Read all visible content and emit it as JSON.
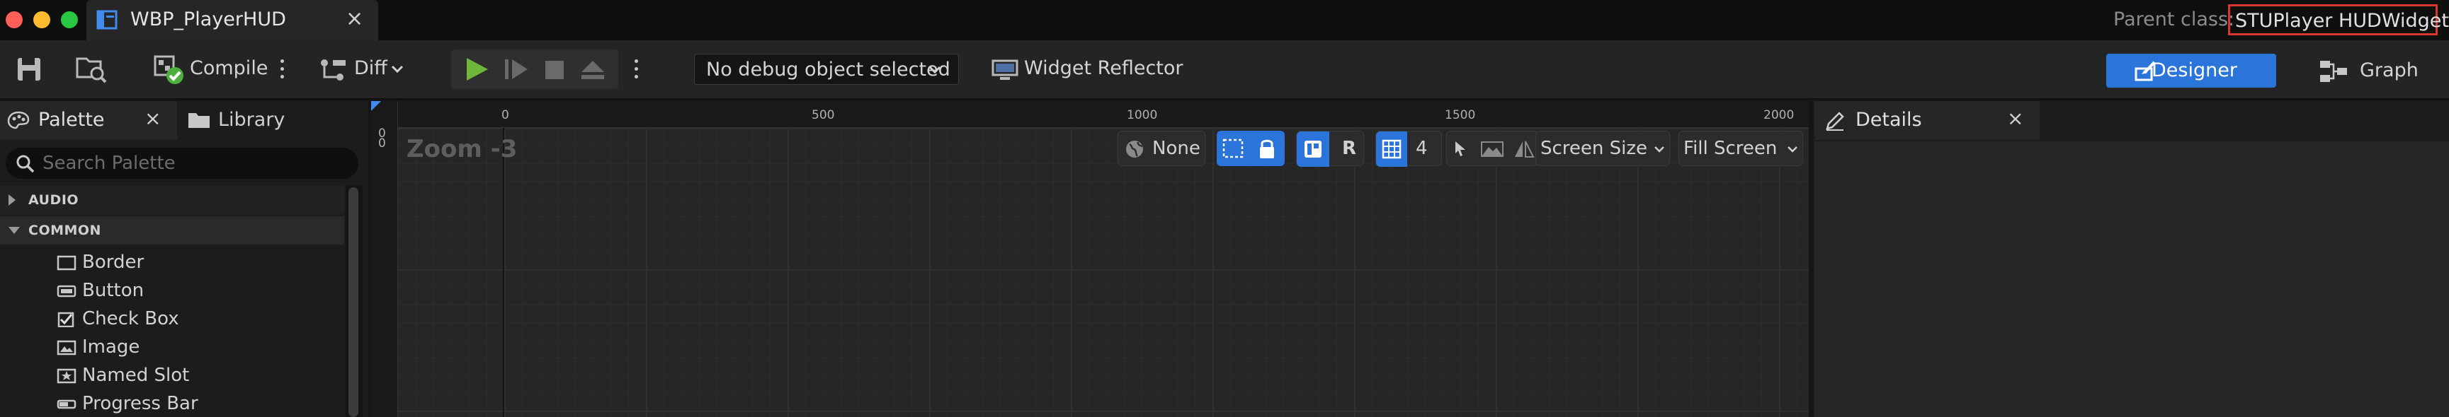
{
  "window": {
    "tab_title": "WBP_PlayerHUD",
    "tab_close": "×",
    "parent_class_label": "Parent class:",
    "parent_class_value": "STUPlayer HUDWidget"
  },
  "toolbar": {
    "compile_label": "Compile",
    "diff_label": "Diff",
    "debug_object": "No debug object selected",
    "widget_reflector_label": "Widget Reflector",
    "designer_label": "Designer",
    "graph_label": "Graph"
  },
  "palette": {
    "tab_label": "Palette",
    "tab_close": "×",
    "library_label": "Library",
    "search_placeholder": "Search Palette",
    "categories": [
      {
        "label": "AUDIO",
        "expanded": false
      },
      {
        "label": "COMMON",
        "expanded": true
      }
    ],
    "items": [
      {
        "label": "Border",
        "icon": "border-icon"
      },
      {
        "label": "Button",
        "icon": "button-icon"
      },
      {
        "label": "Check Box",
        "icon": "checkbox-icon"
      },
      {
        "label": "Image",
        "icon": "image-icon"
      },
      {
        "label": "Named Slot",
        "icon": "named-slot-icon"
      },
      {
        "label": "Progress Bar",
        "icon": "progress-bar-icon"
      }
    ]
  },
  "canvas": {
    "zoom_label": "Zoom -3",
    "ruler_top_ticks": [
      "0",
      "500",
      "1000",
      "1500",
      "2000"
    ],
    "ruler_left_ticks": [
      "0",
      "0"
    ],
    "localization_label": "None",
    "rotation_mode_label": "R",
    "grid_snap_value": "4",
    "screen_size_label": "Screen Size",
    "fill_screen_label": "Fill Screen"
  },
  "details": {
    "tab_label": "Details",
    "tab_close": "×"
  },
  "colors": {
    "accent_blue": "#2b74d9",
    "play_green": "#6fb73a",
    "highlight_red": "#d9362f",
    "panel_bg": "#1c1c1c",
    "canvas_bg": "#262626"
  }
}
